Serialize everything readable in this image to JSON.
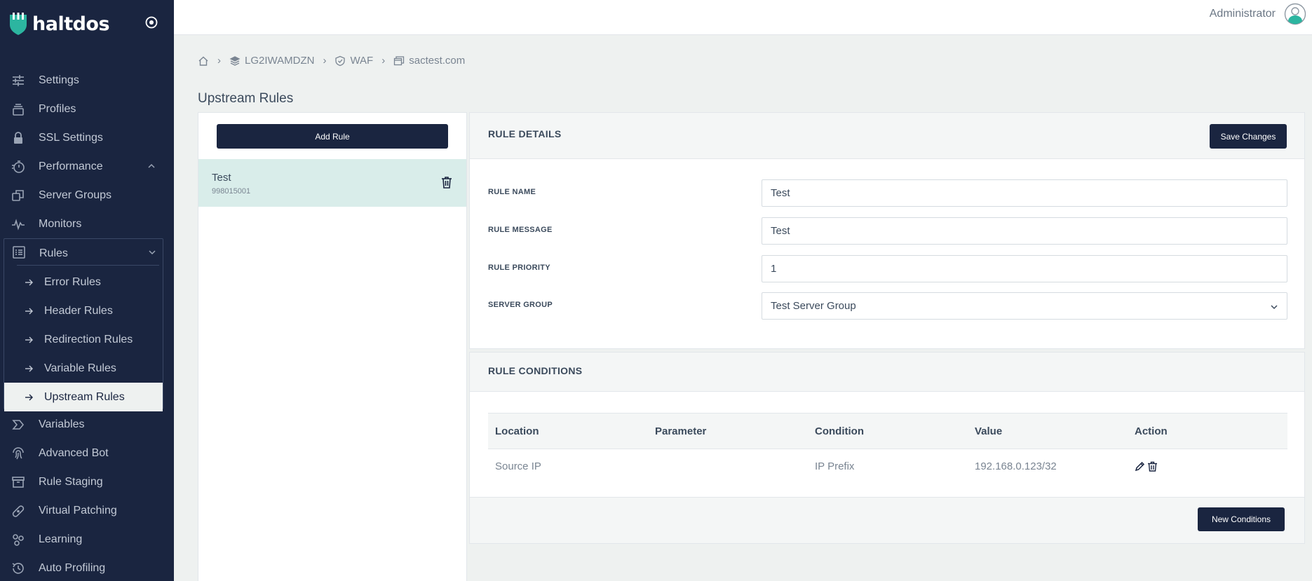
{
  "brand": {
    "name": "haltdos"
  },
  "sidebar": {
    "items": [
      {
        "label": "Settings",
        "icon": "sliders-icon"
      },
      {
        "label": "Profiles",
        "icon": "stack-icon"
      },
      {
        "label": "SSL Settings",
        "icon": "lock-icon"
      },
      {
        "label": "Performance",
        "icon": "stopwatch-icon"
      },
      {
        "label": "Server Groups",
        "icon": "copy-icon"
      },
      {
        "label": "Monitors",
        "icon": "pulse-icon"
      },
      {
        "label": "Rules",
        "icon": "list-icon"
      }
    ],
    "rules_subitems": [
      {
        "label": "Error Rules"
      },
      {
        "label": "Header Rules"
      },
      {
        "label": "Redirection Rules"
      },
      {
        "label": "Variable Rules"
      },
      {
        "label": "Upstream Rules"
      }
    ],
    "lower_items": [
      {
        "label": "Variables",
        "icon": "tag-icon"
      },
      {
        "label": "Advanced Bot",
        "icon": "fingerprint-icon"
      },
      {
        "label": "Rule Staging",
        "icon": "archive-icon"
      },
      {
        "label": "Virtual Patching",
        "icon": "bandage-icon"
      },
      {
        "label": "Learning",
        "icon": "nodes-icon"
      },
      {
        "label": "Auto Profiling",
        "icon": "history-icon"
      }
    ]
  },
  "topbar": {
    "user": "Administrator"
  },
  "breadcrumb": {
    "items": [
      {
        "label": "LG2IWAMDZN"
      },
      {
        "label": "WAF"
      },
      {
        "label": "sactest.com"
      }
    ]
  },
  "page": {
    "title": "Upstream Rules"
  },
  "rule_list": {
    "add_label": "Add Rule",
    "items": [
      {
        "name": "Test",
        "id": "998015001"
      }
    ]
  },
  "rule_details": {
    "title": "RULE DETAILS",
    "save_label": "Save Changes",
    "fields": {
      "name": {
        "label": "RULE NAME",
        "value": "Test"
      },
      "message": {
        "label": "RULE MESSAGE",
        "value": "Test"
      },
      "priority": {
        "label": "RULE PRIORITY",
        "value": "1"
      },
      "server_group": {
        "label": "SERVER GROUP",
        "value": "Test Server Group"
      }
    }
  },
  "rule_conditions": {
    "title": "RULE CONDITIONS",
    "columns": [
      "Location",
      "Parameter",
      "Condition",
      "Value",
      "Action"
    ],
    "rows": [
      {
        "location": "Source IP",
        "parameter": "",
        "condition": "IP Prefix",
        "value": "192.168.0.123/32"
      }
    ],
    "new_label": "New Conditions"
  },
  "colors": {
    "sidebar_bg": "#1a2540",
    "accent": "#1a2540",
    "selected_row": "#d9edea",
    "brand_icon": "#2cb5a0"
  }
}
